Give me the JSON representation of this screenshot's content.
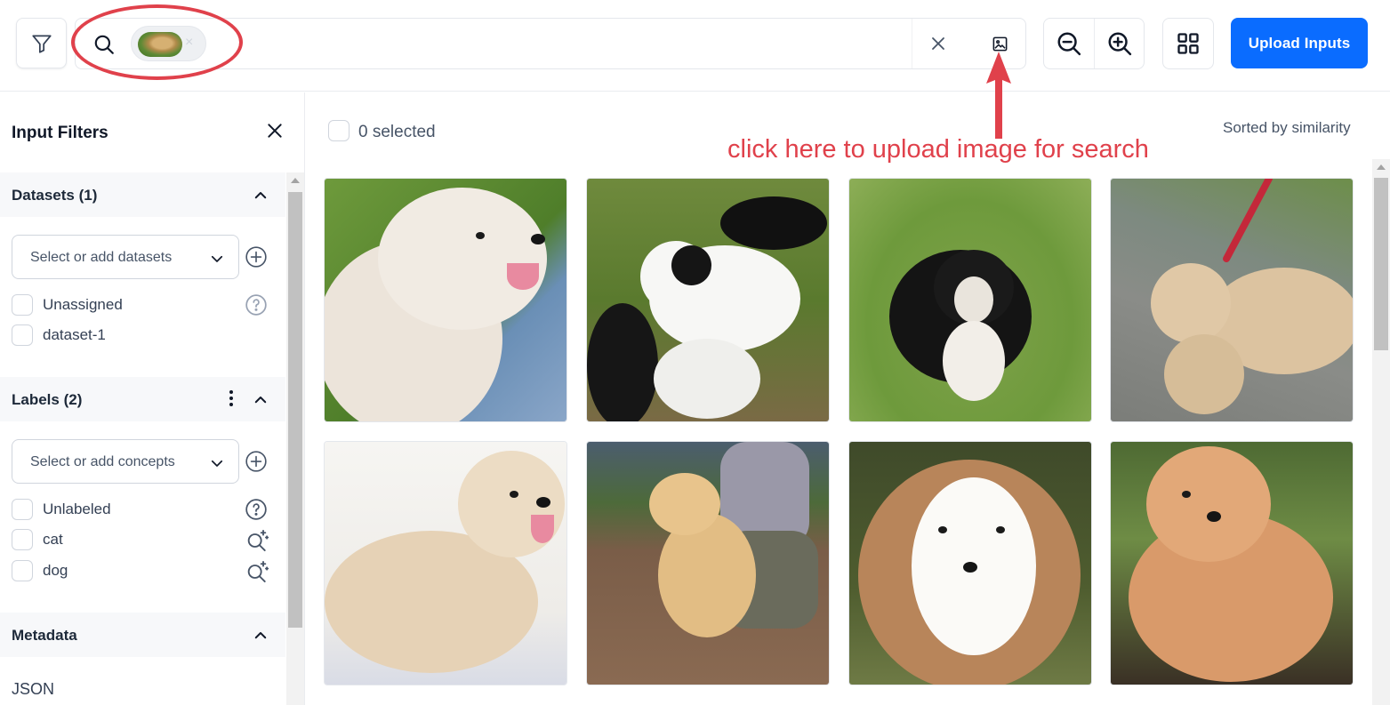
{
  "topbar": {
    "search": {
      "chip_image": "golden retriever thumbnail",
      "chip_remove": "×"
    },
    "upload_button_label": "Upload Inputs"
  },
  "annotation": {
    "text": "click here to upload image for search",
    "color": "#e0414b"
  },
  "sidebar": {
    "title": "Input Filters",
    "datasets": {
      "header": "Datasets (1)",
      "placeholder": "Select or add datasets",
      "items": [
        "Unassigned",
        "dataset-1"
      ]
    },
    "labels": {
      "header": "Labels (2)",
      "placeholder": "Select or add concepts",
      "items": [
        "Unlabeled",
        "cat",
        "dog"
      ]
    },
    "metadata": {
      "header": "Metadata",
      "json_label": "JSON"
    }
  },
  "main": {
    "selected_text": "0 selected",
    "sort_text": "Sorted by similarity",
    "images": [
      "fluffy white dog on grass",
      "white and black puppy with black dogs",
      "black and tan small dog on grass",
      "tan dog on leash on pavement",
      "cream long-haired dog on blanket",
      "tan dog with person kneeling",
      "sheltie puppy close-up",
      "orange cocker spaniel"
    ]
  },
  "colors": {
    "accent": "#0a6cff",
    "annotation": "#e0414b"
  }
}
